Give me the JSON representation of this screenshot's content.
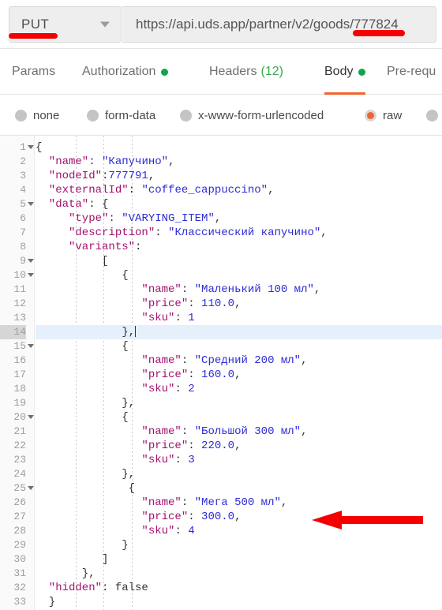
{
  "request_bar": {
    "method": "PUT",
    "method_caret_icon": "chevron-down-icon",
    "url": "https://api.uds.app/partner/v2/goods/777824"
  },
  "annotations": {
    "underline_method": "red-underline-put",
    "underline_goods_id": "red-underline-777824",
    "arrow": "red-left-arrow-pointing-at-price-300",
    "color": "#f50000"
  },
  "tabs": [
    {
      "label": "Params",
      "dot": false,
      "count": null,
      "active": false
    },
    {
      "label": "Authorization",
      "dot": true,
      "count": null,
      "active": false
    },
    {
      "label": "Headers",
      "dot": false,
      "count": "(12)",
      "active": false
    },
    {
      "label": "Body",
      "dot": true,
      "count": null,
      "active": true
    },
    {
      "label": "Pre-requ",
      "dot": false,
      "count": null,
      "active": false
    }
  ],
  "body_types": [
    {
      "label": "none",
      "checked": false
    },
    {
      "label": "form-data",
      "checked": false
    },
    {
      "label": "x-www-form-urlencoded",
      "checked": false
    },
    {
      "label": "raw",
      "checked": true
    },
    {
      "label": "",
      "checked": false
    }
  ],
  "accent_colors": {
    "active_tab_underline": "#f06431",
    "radio_selected": "#f06431",
    "status_dot_green": "#10a54a",
    "header_count_green": "#3ba94c",
    "json_key": "#a3116e",
    "json_string": "#2c2cd6",
    "active_line_bg": "#e6f0fc"
  },
  "editor": {
    "active_line": 14,
    "total_lines": 33,
    "fold_lines": [
      1,
      5,
      9,
      10,
      15,
      20,
      25
    ],
    "lines": [
      {
        "n": 1,
        "tokens": [
          {
            "t": "punc",
            "v": "{"
          }
        ]
      },
      {
        "n": 2,
        "tokens": [
          {
            "t": "key",
            "v": "  \"name\""
          },
          {
            "t": "punc",
            "v": ": "
          },
          {
            "t": "str",
            "v": "\"Капучино\""
          },
          {
            "t": "punc",
            "v": ","
          }
        ]
      },
      {
        "n": 3,
        "tokens": [
          {
            "t": "key",
            "v": "  \"nodeId\""
          },
          {
            "t": "punc",
            "v": ":"
          },
          {
            "t": "num",
            "v": "777791"
          },
          {
            "t": "punc",
            "v": ","
          }
        ]
      },
      {
        "n": 4,
        "tokens": [
          {
            "t": "key",
            "v": "  \"externalId\""
          },
          {
            "t": "punc",
            "v": ": "
          },
          {
            "t": "str",
            "v": "\"coffee_cappuccino\""
          },
          {
            "t": "punc",
            "v": ","
          }
        ]
      },
      {
        "n": 5,
        "tokens": [
          {
            "t": "key",
            "v": "  \"data\""
          },
          {
            "t": "punc",
            "v": ": {"
          }
        ]
      },
      {
        "n": 6,
        "tokens": [
          {
            "t": "key",
            "v": "     \"type\""
          },
          {
            "t": "punc",
            "v": ": "
          },
          {
            "t": "str",
            "v": "\"VARYING_ITEM\""
          },
          {
            "t": "punc",
            "v": ","
          }
        ]
      },
      {
        "n": 7,
        "tokens": [
          {
            "t": "key",
            "v": "     \"description\""
          },
          {
            "t": "punc",
            "v": ": "
          },
          {
            "t": "str",
            "v": "\"Классический капучино\""
          },
          {
            "t": "punc",
            "v": ","
          }
        ]
      },
      {
        "n": 8,
        "tokens": [
          {
            "t": "key",
            "v": "     \"variants\""
          },
          {
            "t": "punc",
            "v": ":"
          }
        ]
      },
      {
        "n": 9,
        "tokens": [
          {
            "t": "punc",
            "v": "          ["
          }
        ]
      },
      {
        "n": 10,
        "tokens": [
          {
            "t": "punc",
            "v": "             {"
          }
        ]
      },
      {
        "n": 11,
        "tokens": [
          {
            "t": "key",
            "v": "                \"name\""
          },
          {
            "t": "punc",
            "v": ": "
          },
          {
            "t": "str",
            "v": "\"Маленький 100 мл\""
          },
          {
            "t": "punc",
            "v": ","
          }
        ]
      },
      {
        "n": 12,
        "tokens": [
          {
            "t": "key",
            "v": "                \"price\""
          },
          {
            "t": "punc",
            "v": ": "
          },
          {
            "t": "num",
            "v": "110.0"
          },
          {
            "t": "punc",
            "v": ","
          }
        ]
      },
      {
        "n": 13,
        "tokens": [
          {
            "t": "key",
            "v": "                \"sku\""
          },
          {
            "t": "punc",
            "v": ": "
          },
          {
            "t": "num",
            "v": "1"
          }
        ]
      },
      {
        "n": 14,
        "tokens": [
          {
            "t": "punc",
            "v": "             },"
          }
        ],
        "caret": true
      },
      {
        "n": 15,
        "tokens": [
          {
            "t": "punc",
            "v": "             {"
          }
        ]
      },
      {
        "n": 16,
        "tokens": [
          {
            "t": "key",
            "v": "                \"name\""
          },
          {
            "t": "punc",
            "v": ": "
          },
          {
            "t": "str",
            "v": "\"Средний 200 мл\""
          },
          {
            "t": "punc",
            "v": ","
          }
        ]
      },
      {
        "n": 17,
        "tokens": [
          {
            "t": "key",
            "v": "                \"price\""
          },
          {
            "t": "punc",
            "v": ": "
          },
          {
            "t": "num",
            "v": "160.0"
          },
          {
            "t": "punc",
            "v": ","
          }
        ]
      },
      {
        "n": 18,
        "tokens": [
          {
            "t": "key",
            "v": "                \"sku\""
          },
          {
            "t": "punc",
            "v": ": "
          },
          {
            "t": "num",
            "v": "2"
          }
        ]
      },
      {
        "n": 19,
        "tokens": [
          {
            "t": "punc",
            "v": "             },"
          }
        ]
      },
      {
        "n": 20,
        "tokens": [
          {
            "t": "punc",
            "v": "             {"
          }
        ]
      },
      {
        "n": 21,
        "tokens": [
          {
            "t": "key",
            "v": "                \"name\""
          },
          {
            "t": "punc",
            "v": ": "
          },
          {
            "t": "str",
            "v": "\"Большой 300 мл\""
          },
          {
            "t": "punc",
            "v": ","
          }
        ]
      },
      {
        "n": 22,
        "tokens": [
          {
            "t": "key",
            "v": "                \"price\""
          },
          {
            "t": "punc",
            "v": ": "
          },
          {
            "t": "num",
            "v": "220.0"
          },
          {
            "t": "punc",
            "v": ","
          }
        ]
      },
      {
        "n": 23,
        "tokens": [
          {
            "t": "key",
            "v": "                \"sku\""
          },
          {
            "t": "punc",
            "v": ": "
          },
          {
            "t": "num",
            "v": "3"
          }
        ]
      },
      {
        "n": 24,
        "tokens": [
          {
            "t": "punc",
            "v": "             },"
          }
        ]
      },
      {
        "n": 25,
        "tokens": [
          {
            "t": "punc",
            "v": "              {"
          }
        ]
      },
      {
        "n": 26,
        "tokens": [
          {
            "t": "key",
            "v": "                \"name\""
          },
          {
            "t": "punc",
            "v": ": "
          },
          {
            "t": "str",
            "v": "\"Мега 500 мл\""
          },
          {
            "t": "punc",
            "v": ","
          }
        ]
      },
      {
        "n": 27,
        "tokens": [
          {
            "t": "key",
            "v": "                \"price\""
          },
          {
            "t": "punc",
            "v": ": "
          },
          {
            "t": "num",
            "v": "300.0"
          },
          {
            "t": "punc",
            "v": ","
          }
        ]
      },
      {
        "n": 28,
        "tokens": [
          {
            "t": "key",
            "v": "                \"sku\""
          },
          {
            "t": "punc",
            "v": ": "
          },
          {
            "t": "num",
            "v": "4"
          }
        ]
      },
      {
        "n": 29,
        "tokens": [
          {
            "t": "punc",
            "v": "             }"
          }
        ]
      },
      {
        "n": 30,
        "tokens": [
          {
            "t": "punc",
            "v": "          ]"
          }
        ]
      },
      {
        "n": 31,
        "tokens": [
          {
            "t": "punc",
            "v": "       },"
          }
        ]
      },
      {
        "n": 32,
        "tokens": [
          {
            "t": "key",
            "v": "  \"hidden\""
          },
          {
            "t": "punc",
            "v": ": "
          },
          {
            "t": "plain",
            "v": "false"
          }
        ]
      },
      {
        "n": 33,
        "tokens": [
          {
            "t": "punc",
            "v": "  }"
          }
        ]
      }
    ]
  }
}
